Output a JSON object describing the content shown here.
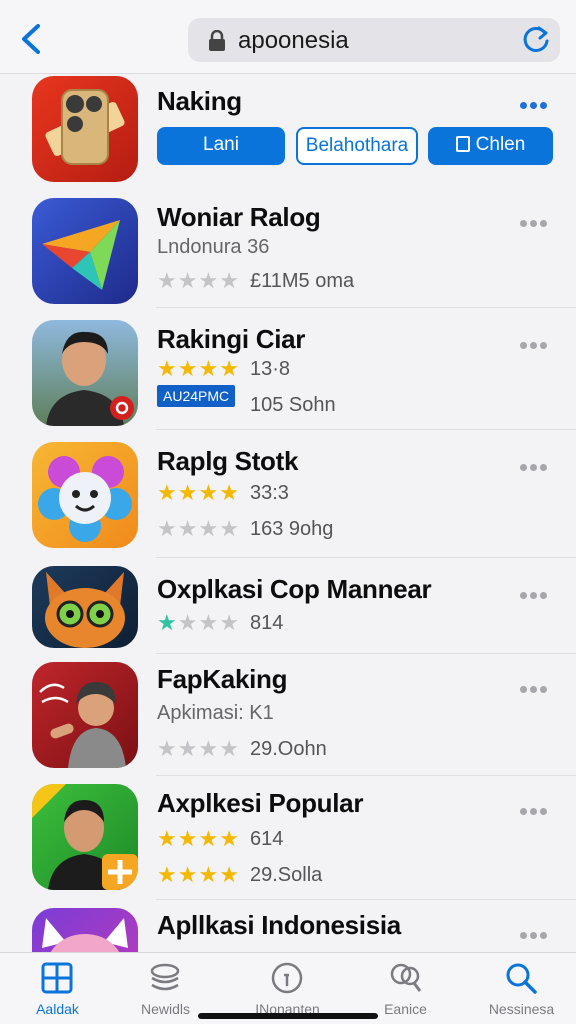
{
  "header": {
    "url": "apoonesia"
  },
  "apps": [
    {
      "title": "Naking",
      "buttons": [
        "Lani",
        "Belahothara",
        "Chlen"
      ]
    },
    {
      "title": "Woniar Ralog",
      "subtitle": "Lndonura 36",
      "rating_metric": "£11M5 oma",
      "rating": 0
    },
    {
      "title": "Rakingi Ciar",
      "rating": 4,
      "rating_metric": "13·8",
      "badge": "AU24PMC",
      "metric2": "105 Sohn"
    },
    {
      "title": "Raplg Stotk",
      "rating": 4,
      "rating_metric": "33:3",
      "rating2": 0,
      "metric2": "163 9ohg"
    },
    {
      "title": "Oxplkasi Cop Mannear",
      "rating": 1,
      "rating_metric": "814"
    },
    {
      "title": "FapKaking",
      "subtitle": "Apkimasi: K1",
      "rating2": 0,
      "metric2": "29.Oohn"
    },
    {
      "title": "Axplkesi Popular",
      "rating": 4,
      "rating_metric": "614",
      "rating2": 4,
      "metric2": "29.Solla"
    },
    {
      "title": "Apllkasi Indonesisia"
    }
  ],
  "tabs": [
    {
      "label": "Aaldak",
      "icon": "grid-icon",
      "active": true
    },
    {
      "label": "Newidls",
      "icon": "stack-icon",
      "active": false
    },
    {
      "label": "INonanten",
      "icon": "info-circle-icon",
      "active": false
    },
    {
      "label": "Eanice",
      "icon": "people-search-icon",
      "active": false
    },
    {
      "label": "Nessinesa",
      "icon": "search-icon",
      "active": false
    }
  ],
  "colors": {
    "accent": "#0a74db",
    "star_gold": "#f5b800",
    "star_grey": "#c4c4c8",
    "star_teal": "#2ec4a0"
  }
}
